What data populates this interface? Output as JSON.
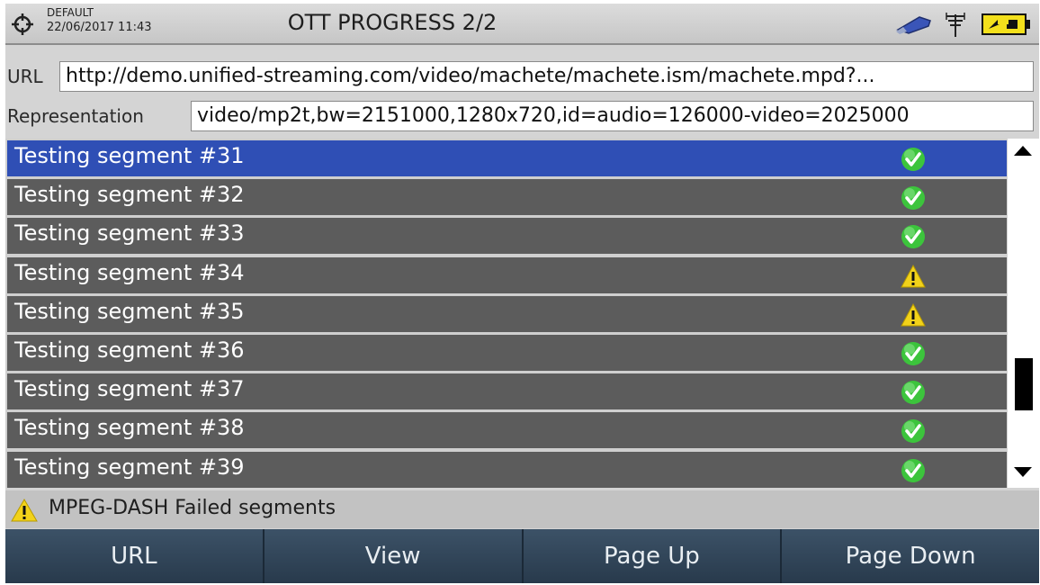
{
  "header": {
    "preset": "DEFAULT",
    "datetime": "22/06/2017 11:43",
    "title": "OTT PROGRESS 2/2"
  },
  "url": {
    "label": "URL",
    "value": "http://demo.unified-streaming.com/video/machete/machete.ism/machete.mpd?..."
  },
  "representation": {
    "label": "Representation",
    "value": "video/mp2t,bw=2151000,1280x720,id=audio=126000-video=2025000"
  },
  "segments": [
    {
      "label": "Testing segment #31",
      "status": "ok",
      "selected": true
    },
    {
      "label": "Testing segment #32",
      "status": "ok"
    },
    {
      "label": "Testing segment #33",
      "status": "ok"
    },
    {
      "label": "Testing segment #34",
      "status": "warning"
    },
    {
      "label": "Testing segment #35",
      "status": "warning"
    },
    {
      "label": "Testing segment #36",
      "status": "ok"
    },
    {
      "label": "Testing segment #37",
      "status": "ok"
    },
    {
      "label": "Testing segment #38",
      "status": "ok"
    },
    {
      "label": "Testing segment #39",
      "status": "ok"
    }
  ],
  "status_bar": {
    "icon": "warning-icon",
    "text": "MPEG-DASH Failed segments"
  },
  "softkeys": {
    "url": "URL",
    "view": "View",
    "page_up": "Page Up",
    "page_down": "Page Down"
  },
  "colors": {
    "selected_row": "#2f4fb5",
    "row": "#5c5c5c",
    "ok": "#3cc43c",
    "warning": "#f2d21a"
  }
}
